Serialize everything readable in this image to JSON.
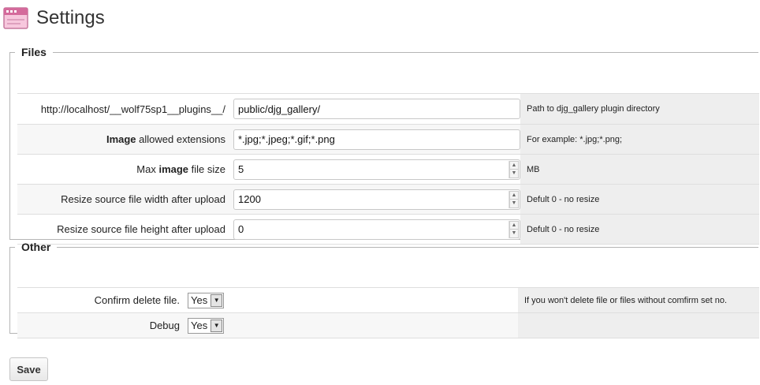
{
  "page": {
    "title": "Settings"
  },
  "files": {
    "legend": "Files",
    "rows": [
      {
        "label": "http://localhost/__wolf75sp1__plugins__/",
        "value": "public/djg_gallery/",
        "help": "Path to djg_gallery plugin directory"
      },
      {
        "label_bold": "Image",
        "label_rest": " allowed extensions",
        "value": "*.jpg;*.jpeg;*.gif;*.png",
        "help": "For example: *.jpg;*.png;"
      },
      {
        "label_pre": "Max ",
        "label_bold": "image",
        "label_post": " file size",
        "value": "5",
        "help": "MB"
      },
      {
        "label": "Resize source file width after upload",
        "value": "1200",
        "help": "Defult 0 - no resize"
      },
      {
        "label": "Resize source file height after upload",
        "value": "0",
        "help": "Defult 0 - no resize"
      }
    ]
  },
  "other": {
    "legend": "Other",
    "rows": [
      {
        "label": "Confirm delete file.",
        "value": "Yes",
        "help": "If you won't delete file or files without comfirm set no."
      },
      {
        "label": "Debug",
        "value": "Yes",
        "help": ""
      }
    ]
  },
  "save_label": "Save",
  "icons": {
    "settings": "settings-icon",
    "spin_up": "▲",
    "spin_down": "▼",
    "select_arrow": "▼"
  },
  "colors": {
    "help_bg": "#eeeeee",
    "border": "#b5b5b5"
  }
}
